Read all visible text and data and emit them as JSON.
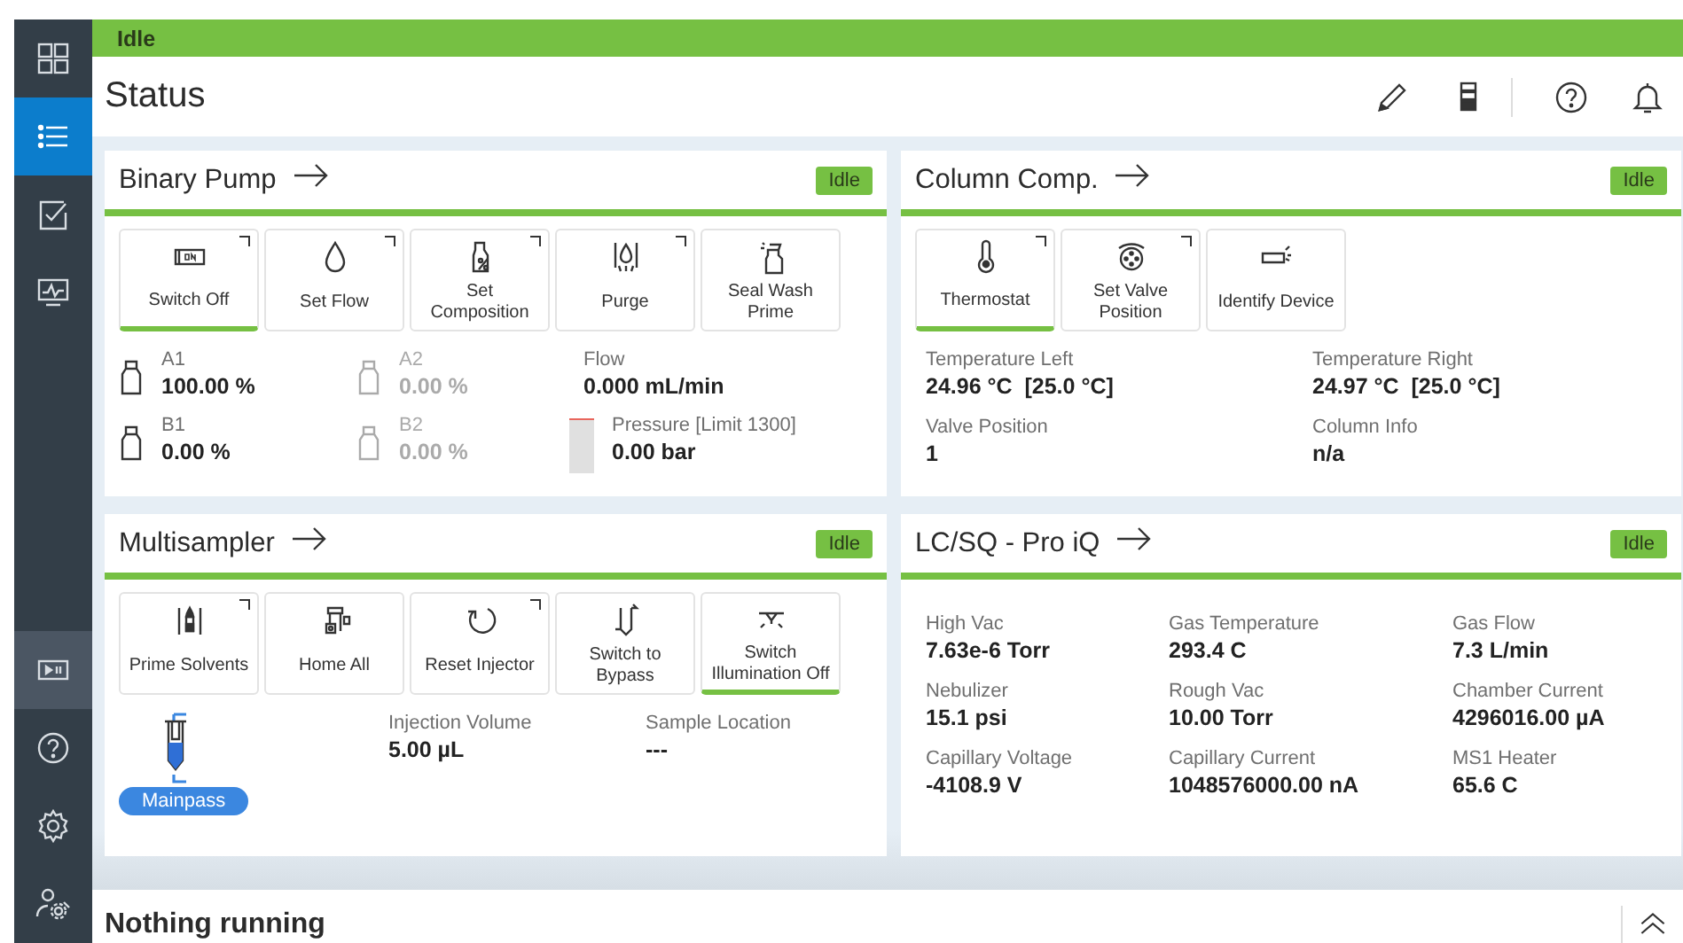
{
  "status_strip": {
    "text": "Idle"
  },
  "sidebar": {
    "items": [
      {
        "selected": false,
        "highlighted": false
      },
      {
        "selected": true,
        "highlighted": false
      },
      {
        "selected": false,
        "highlighted": false
      },
      {
        "selected": false,
        "highlighted": false
      },
      {
        "selected": false,
        "highlighted": true
      },
      {
        "selected": false,
        "highlighted": false
      },
      {
        "selected": false,
        "highlighted": false
      },
      {
        "selected": false,
        "highlighted": false
      }
    ]
  },
  "header": {
    "title": "Status"
  },
  "cards": [
    {
      "kind": "pump",
      "title": "Binary Pump",
      "status": "Idle",
      "buttons": [
        {
          "label": "Switch Off",
          "selected": true,
          "menu": true
        },
        {
          "label": "Set Flow",
          "selected": false,
          "menu": true
        },
        {
          "label": "Set Composition",
          "selected": false,
          "menu": true
        },
        {
          "label": "Purge",
          "selected": false,
          "menu": true
        },
        {
          "label": "Seal Wash Prime",
          "selected": false,
          "menu": false
        }
      ],
      "fields": [
        {
          "kind": "bottle",
          "label": "A1",
          "value": "100.00 %",
          "dimmed": false
        },
        {
          "kind": "bottle",
          "label": "A2",
          "value": "0.00 %",
          "dimmed": true
        },
        {
          "kind": "plain",
          "label": "Flow",
          "value": "0.000 mL/min"
        },
        {
          "kind": "bottle",
          "label": "B1",
          "value": "0.00 %",
          "dimmed": false
        },
        {
          "kind": "bottle",
          "label": "B2",
          "value": "0.00 %",
          "dimmed": true
        },
        {
          "kind": "gauge",
          "label": "Pressure [Limit 1300]",
          "value": "0.00 bar"
        }
      ]
    },
    {
      "kind": "column",
      "title": "Column Comp.",
      "status": "Idle",
      "buttons": [
        {
          "label": "Thermostat",
          "selected": true,
          "menu": true
        },
        {
          "label": "Set Valve Position",
          "selected": false,
          "menu": true
        },
        {
          "label": "Identify Device",
          "selected": false,
          "menu": false
        }
      ],
      "fields": [
        {
          "kind": "plain",
          "label": "Temperature Left",
          "value": "24.96 °C  [25.0 °C]"
        },
        {
          "kind": "plain",
          "label": "Temperature Right",
          "value": "24.97 °C  [25.0 °C]"
        },
        {
          "kind": "plain",
          "label": "Valve Position",
          "value": "1"
        },
        {
          "kind": "plain",
          "label": "Column Info",
          "value": "n/a"
        }
      ]
    },
    {
      "kind": "sampler",
      "title": "Multisampler",
      "status": "Idle",
      "buttons": [
        {
          "label": "Prime Solvents",
          "selected": false,
          "menu": true
        },
        {
          "label": "Home All",
          "selected": false,
          "menu": false
        },
        {
          "label": "Reset Injector",
          "selected": false,
          "menu": true
        },
        {
          "label": "Switch to Bypass",
          "selected": false,
          "menu": false
        },
        {
          "label": "Switch Illumination Off",
          "selected": true,
          "menu": false
        }
      ],
      "injector": {
        "label": "Mainpass"
      },
      "fields": [
        {
          "kind": "plain",
          "label": "Injection Volume",
          "value": "5.00 µL"
        },
        {
          "kind": "plain",
          "label": "Sample Location",
          "value": "---"
        }
      ]
    },
    {
      "kind": "ms",
      "title": "LC/SQ - Pro iQ",
      "status": "Idle",
      "fields": [
        {
          "kind": "plain",
          "label": "High Vac",
          "value": "7.63e-6 Torr"
        },
        {
          "kind": "plain",
          "label": "Gas Temperature",
          "value": "293.4 C"
        },
        {
          "kind": "plain",
          "label": "Gas Flow",
          "value": "7.3 L/min"
        },
        {
          "kind": "plain",
          "label": "Nebulizer",
          "value": "15.1 psi"
        },
        {
          "kind": "plain",
          "label": "Rough Vac",
          "value": "10.00 Torr"
        },
        {
          "kind": "plain",
          "label": "Chamber Current",
          "value": "4296016.00 µA"
        },
        {
          "kind": "plain",
          "label": "Capillary Voltage",
          "value": "-4108.9 V"
        },
        {
          "kind": "plain",
          "label": "Capillary Current",
          "value": "1048576000.00 nA"
        },
        {
          "kind": "plain",
          "label": "MS1 Heater",
          "value": "65.6 C"
        }
      ]
    }
  ],
  "run_panel": {
    "title": "Nothing running"
  }
}
